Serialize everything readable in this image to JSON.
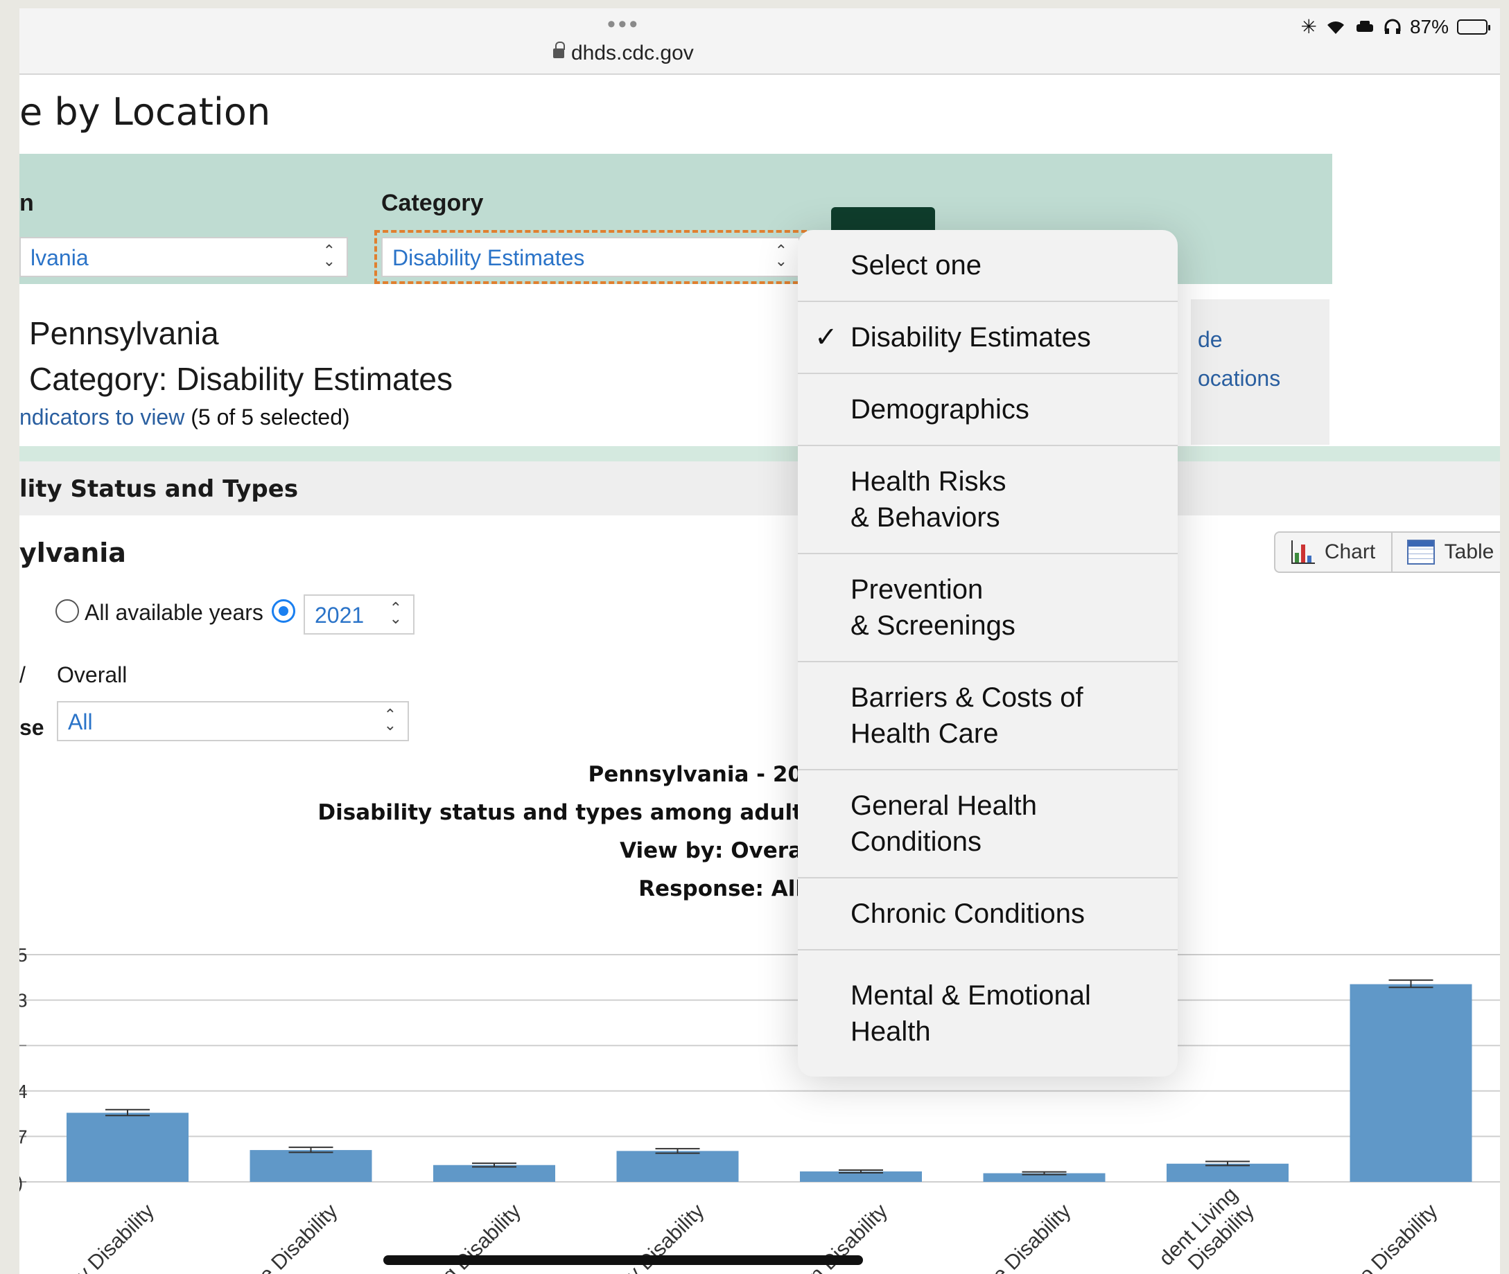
{
  "browser": {
    "dots": "•••",
    "url": "dhds.cdc.gov"
  },
  "status_bar": {
    "battery": "87%"
  },
  "page": {
    "title": "e by Location"
  },
  "filters": {
    "location_label": "n",
    "location_value": "lvania",
    "category_label": "Category",
    "category_value": "Disability Estimates"
  },
  "info_box": {
    "line1": "de",
    "line2": "ocations"
  },
  "summary": {
    "location": "Pennsylvania",
    "category": "Category: Disability Estimates",
    "indicators_link": "ndicators to view",
    "indicators_count": "(5 of 5 selected)"
  },
  "section": {
    "title": "lity Status and Types",
    "state": "ylvania"
  },
  "view_toggle": {
    "chart": "Chart",
    "table": "Table"
  },
  "controls": {
    "all_years_label": "All available years",
    "year_value": "2021",
    "view_by_label": "/",
    "view_by_value": "Overall",
    "response_label": "se",
    "response_value": "All"
  },
  "chart_titles": {
    "line1": "Pennsylvania - 20",
    "line2": "Disability status and types among adult",
    "line3": "View by: Overa",
    "line4": "Response: All"
  },
  "chart_data": {
    "type": "bar",
    "ytick_labels": [
      "5",
      "3",
      "",
      "4",
      "7",
      ")"
    ],
    "categories": [
      "y Disability",
      "e Disability",
      "g Disability",
      "ity Disability",
      "n Disability",
      "e Disability",
      "dent Living\nDisability",
      "o Disability"
    ],
    "values": [
      15.2,
      7.0,
      3.7,
      6.8,
      2.3,
      1.9,
      4.0,
      43.5
    ],
    "error_low": [
      14.6,
      6.5,
      3.3,
      6.3,
      2.0,
      1.6,
      3.6,
      42.8
    ],
    "error_high": [
      15.9,
      7.6,
      4.1,
      7.3,
      2.6,
      2.2,
      4.5,
      44.4
    ],
    "ylim": [
      0,
      50
    ],
    "bar_color": "#6098c8",
    "grid": true
  },
  "menu": {
    "items": [
      {
        "label": "Select one",
        "checked": false
      },
      {
        "label": "Disability Estimates",
        "checked": true
      },
      {
        "label": "Demographics",
        "checked": false
      },
      {
        "label": "Health Risks\n& Behaviors",
        "checked": false
      },
      {
        "label": "Prevention\n& Screenings",
        "checked": false
      },
      {
        "label": "Barriers & Costs of\nHealth Care",
        "checked": false
      },
      {
        "label": "General Health\nConditions",
        "checked": false
      },
      {
        "label": "Chronic Conditions",
        "checked": false
      },
      {
        "label": "Mental & Emotional\nHealth",
        "checked": false
      }
    ],
    "check_glyph": "✓"
  },
  "colors": {
    "filter_band": "#bfdcd2",
    "go_button": "#0f3d2c",
    "link": "#2a5fa0",
    "select_text": "#2a73c8",
    "focus_outline": "#e08030",
    "radio_on": "#1a7ff0"
  }
}
